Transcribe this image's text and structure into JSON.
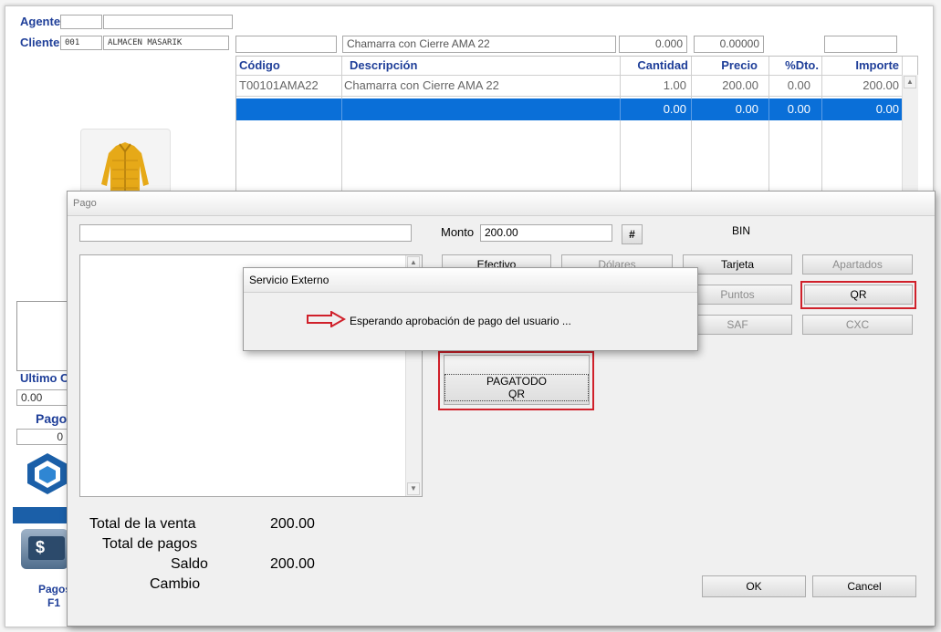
{
  "header": {
    "agente_label": "Agente",
    "cliente_label": "Cliente",
    "cliente_code": "001",
    "cliente_name": "ALMACEN MASARIK",
    "entry_description": "Chamarra con Cierre AMA 22",
    "entry_cantidad": "0.000",
    "entry_precio": "0.00000"
  },
  "grid": {
    "columns": [
      "Código",
      "Descripción",
      "Cantidad",
      "Precio",
      "%Dto.",
      "Importe"
    ],
    "rows": [
      [
        "T00101AMA22",
        "Chamarra con Cierre AMA 22",
        "1.00",
        "200.00",
        "0.00",
        "200.00"
      ],
      [
        "",
        "",
        "0.00",
        "0.00",
        "0.00",
        "0.00"
      ]
    ]
  },
  "left_panel": {
    "ultimo_label": "Ultimo C",
    "ultimo_value": "0.00",
    "pagos_label": "Pago",
    "pagos_value": "0",
    "pagos_button_label": "Pagos",
    "pagos_button_key": "F1",
    "dollar_glyph": "$"
  },
  "pago_dialog": {
    "title": "Pago",
    "monto_label": "Monto",
    "monto_value": "200.00",
    "hash_button": "#",
    "bin_label": "BIN",
    "buttons": {
      "efectivo": "Efectivo",
      "dolares": "Dólares",
      "tarjeta": "Tarjeta",
      "apartados": "Apartados",
      "puntos": "Puntos",
      "qr": "QR",
      "saf": "SAF",
      "cxc": "CXC",
      "pagatodo_qr": "PAGATODO QR",
      "ok": "OK",
      "cancel": "Cancel"
    },
    "totals": {
      "total_venta_label": "Total de la venta",
      "total_venta_value": "200.00",
      "total_pagos_label": "Total de pagos",
      "total_pagos_value": "",
      "saldo_label": "Saldo",
      "saldo_value": "200.00",
      "cambio_label": "Cambio",
      "cambio_value": ""
    }
  },
  "servicio_dialog": {
    "title": "Servicio Externo",
    "message": "Esperando aprobación de pago del usuario ..."
  },
  "colors": {
    "label_blue": "#1f3f99",
    "selection_blue": "#0a6fd8",
    "highlight_red": "#d0202a"
  }
}
